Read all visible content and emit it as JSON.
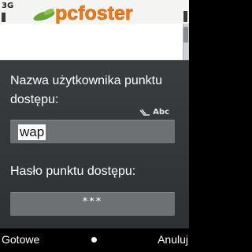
{
  "status": {
    "network": "3G"
  },
  "background": {
    "logo_text": "pcfoster"
  },
  "dialog": {
    "username_label": "Nazwa użytkownika punktu dostępu:",
    "input_mode": "Abc",
    "username_value": "wap",
    "password_label": "Hasło punktu dostępu:",
    "password_value": "***"
  },
  "softkeys": {
    "left": "Gotowe",
    "right": "Anuluj"
  },
  "colors": {
    "dialog_bg": "#35383a",
    "field_bg": "#6e7174",
    "logo_orange": "#f07a1a",
    "logo_green": "#6aa339"
  }
}
